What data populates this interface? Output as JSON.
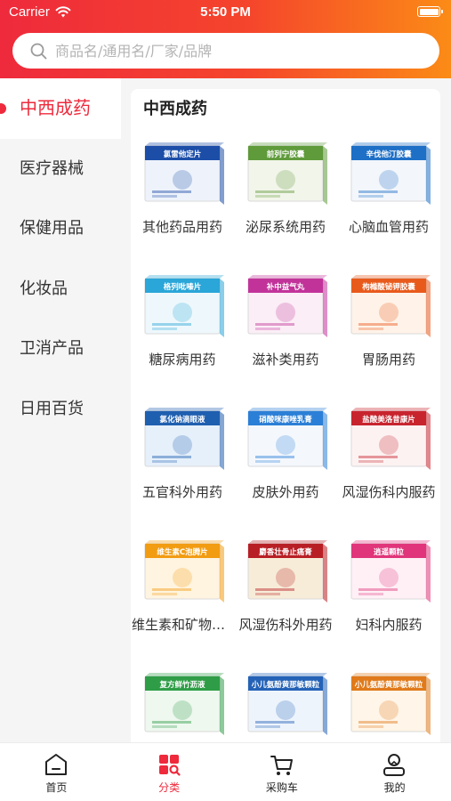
{
  "status_bar": {
    "carrier": "Carrier",
    "time": "5:50 PM"
  },
  "search": {
    "placeholder": "商品名/通用名/厂家/品牌"
  },
  "sidebar": {
    "items": [
      {
        "label": "中西成药",
        "active": true
      },
      {
        "label": "医疗器械",
        "active": false
      },
      {
        "label": "保健用品",
        "active": false
      },
      {
        "label": "化妆品",
        "active": false
      },
      {
        "label": "卫消产品",
        "active": false
      },
      {
        "label": "日用百货",
        "active": false
      }
    ]
  },
  "content": {
    "title": "中西成药",
    "categories": [
      {
        "label": "其他药品用药",
        "box_text": "氯雷他定片",
        "colors": [
          "#1c4ea8",
          "#eef3fb"
        ]
      },
      {
        "label": "泌尿系统用药",
        "box_text": "前列宁胶囊",
        "colors": [
          "#5f9a3b",
          "#f2f5ea"
        ]
      },
      {
        "label": "心脑血管用药",
        "box_text": "辛伐他汀胶囊",
        "colors": [
          "#1e6fc6",
          "#f3f6fb"
        ]
      },
      {
        "label": "糖尿病用药",
        "box_text": "格列吡嗪片",
        "colors": [
          "#2aa6d8",
          "#eef8fc"
        ]
      },
      {
        "label": "滋补类用药",
        "box_text": "补中益气丸",
        "colors": [
          "#c2339a",
          "#fbeef6"
        ]
      },
      {
        "label": "胃肠用药",
        "box_text": "枸橼酸铋钾胶囊",
        "colors": [
          "#e85a1c",
          "#fff3e9"
        ]
      },
      {
        "label": "五官科外用药",
        "box_text": "氯化钠滴眼液",
        "colors": [
          "#1f5fb0",
          "#e6f0fb"
        ]
      },
      {
        "label": "皮肤外用药",
        "box_text": "硝酸咪康唑乳膏",
        "colors": [
          "#2b7fd6",
          "#f4f8fd"
        ]
      },
      {
        "label": "风湿伤科内服药",
        "box_text": "盐酸美洛昔康片",
        "colors": [
          "#c8242e",
          "#fdf2f2"
        ]
      },
      {
        "label": "维生素和矿物质补充剂",
        "box_text": "维生素C泡腾片",
        "colors": [
          "#f29c12",
          "#fff4df"
        ]
      },
      {
        "label": "风湿伤科外用药",
        "box_text": "麝香壮骨止痛膏",
        "colors": [
          "#b81f25",
          "#f7ecd8"
        ]
      },
      {
        "label": "妇科内服药",
        "box_text": "逍遥颗粒",
        "colors": [
          "#e0357a",
          "#fff0f6"
        ]
      },
      {
        "label": "",
        "box_text": "复方鲜竹沥液",
        "colors": [
          "#2f9d47",
          "#eef8ef"
        ]
      },
      {
        "label": "",
        "box_text": "小儿氨酚黄那敏颗粒",
        "colors": [
          "#2462b7",
          "#eef4fc"
        ]
      },
      {
        "label": "",
        "box_text": "小儿氨酚黄那敏颗粒",
        "colors": [
          "#e07a1a",
          "#fff5e8"
        ]
      }
    ]
  },
  "tabbar": {
    "items": [
      {
        "label": "首页",
        "icon": "home-icon",
        "active": false
      },
      {
        "label": "分类",
        "icon": "category-icon",
        "active": true
      },
      {
        "label": "采购车",
        "icon": "cart-icon",
        "active": false
      },
      {
        "label": "我的",
        "icon": "profile-icon",
        "active": false
      }
    ]
  },
  "colors": {
    "accent": "#ee2a3c",
    "gradient_end": "#fb8b16"
  }
}
